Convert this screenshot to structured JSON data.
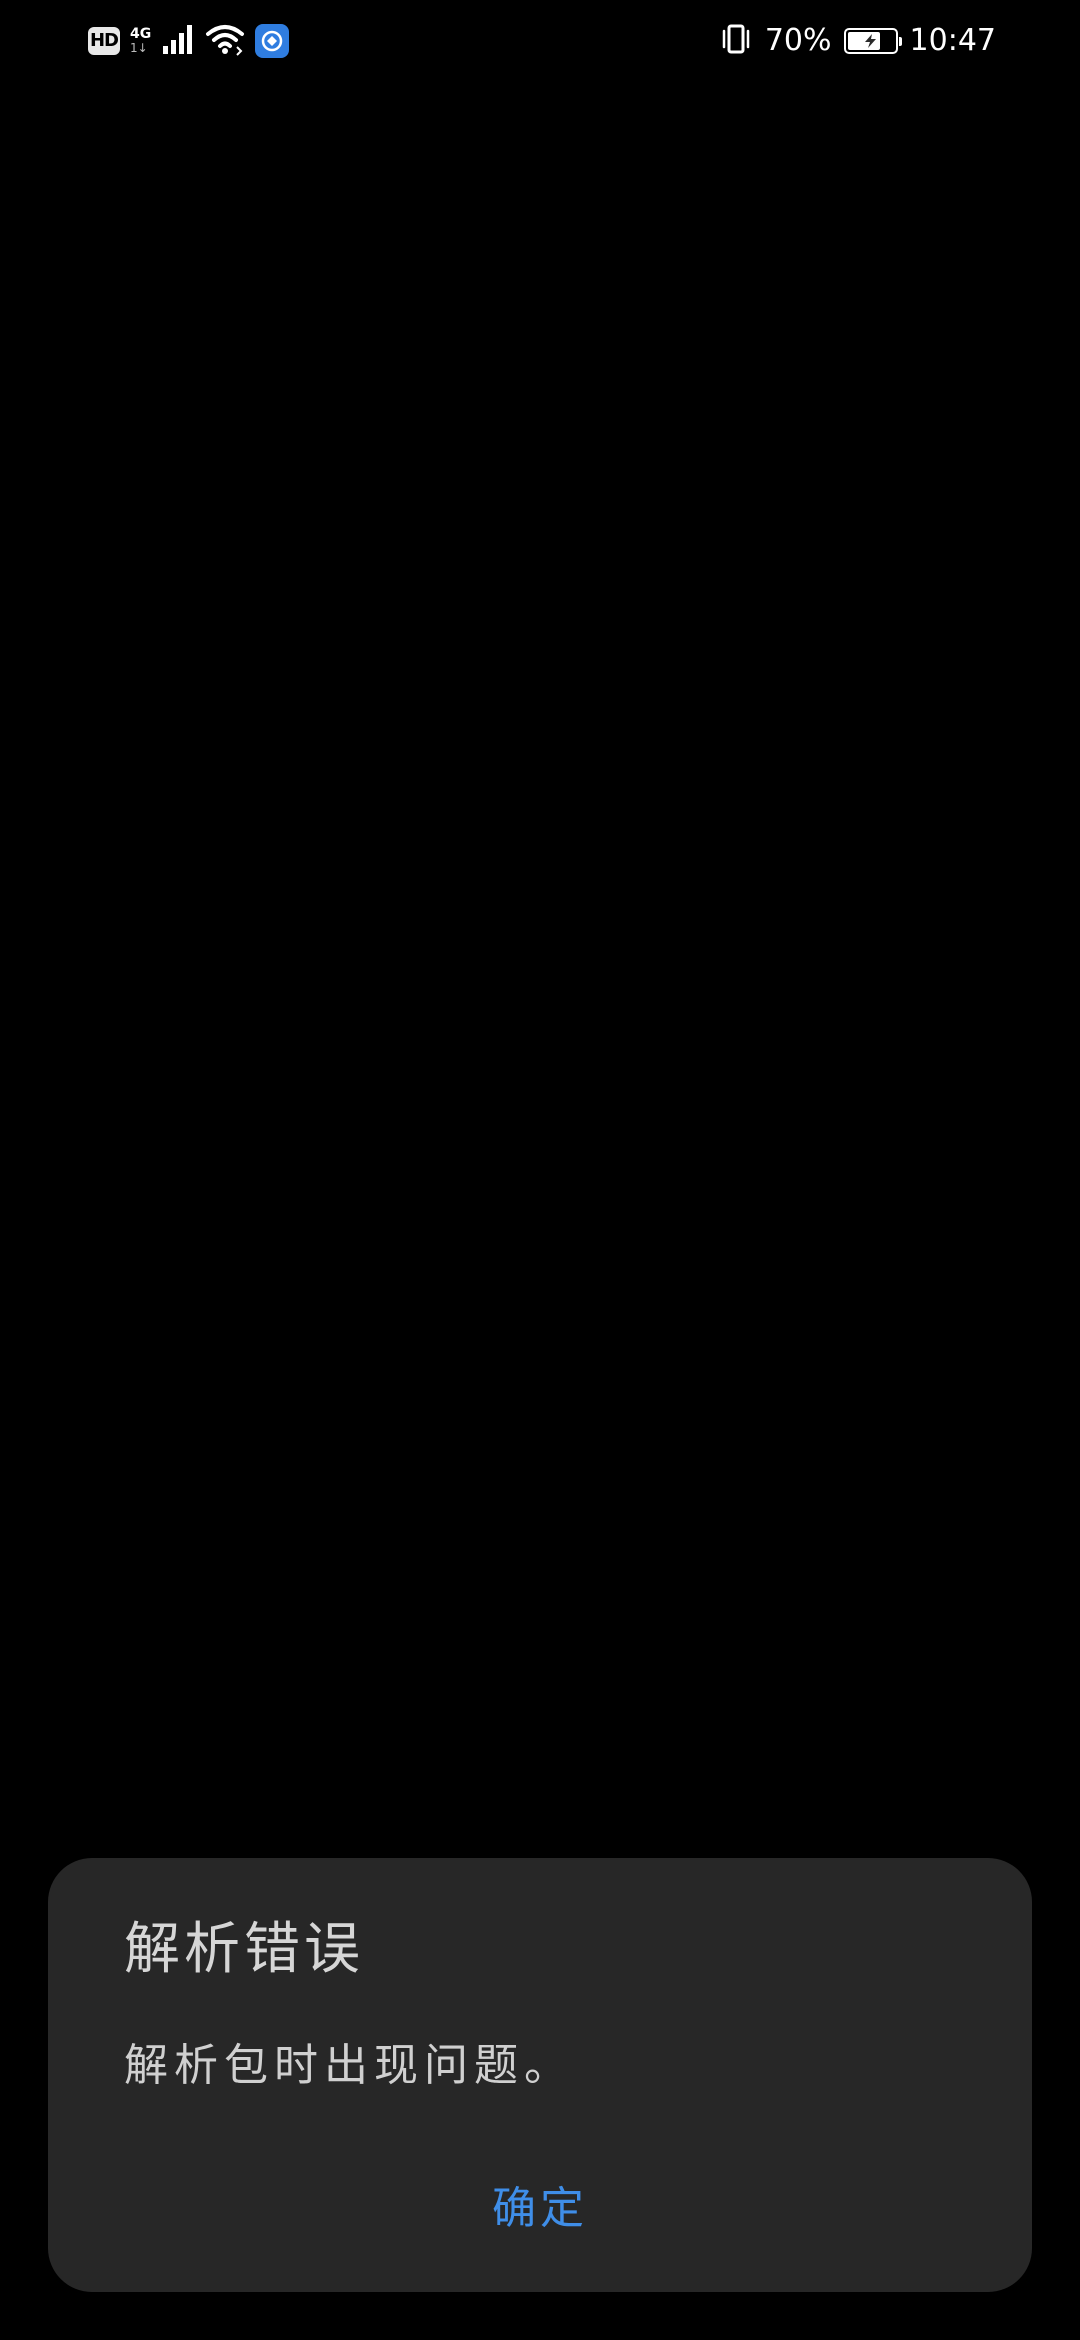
{
  "status_bar": {
    "hd_label": "HD",
    "network_type": "4G",
    "network_sub": "1↓",
    "battery_percent_text": "70%",
    "battery_level": 0.7,
    "time": "10:47",
    "icons": [
      "hd-icon",
      "signal-icon",
      "wifi-icon",
      "vpn-icon",
      "vibrate-icon",
      "battery-icon",
      "charging-icon"
    ]
  },
  "dialog": {
    "title": "解析错误",
    "message": "解析包时出现问题。",
    "confirm_label": "确定"
  },
  "colors": {
    "background": "#000000",
    "dialog_background": "#272727",
    "accent": "#3f8ee8",
    "text_primary": "#d6d6d6"
  }
}
